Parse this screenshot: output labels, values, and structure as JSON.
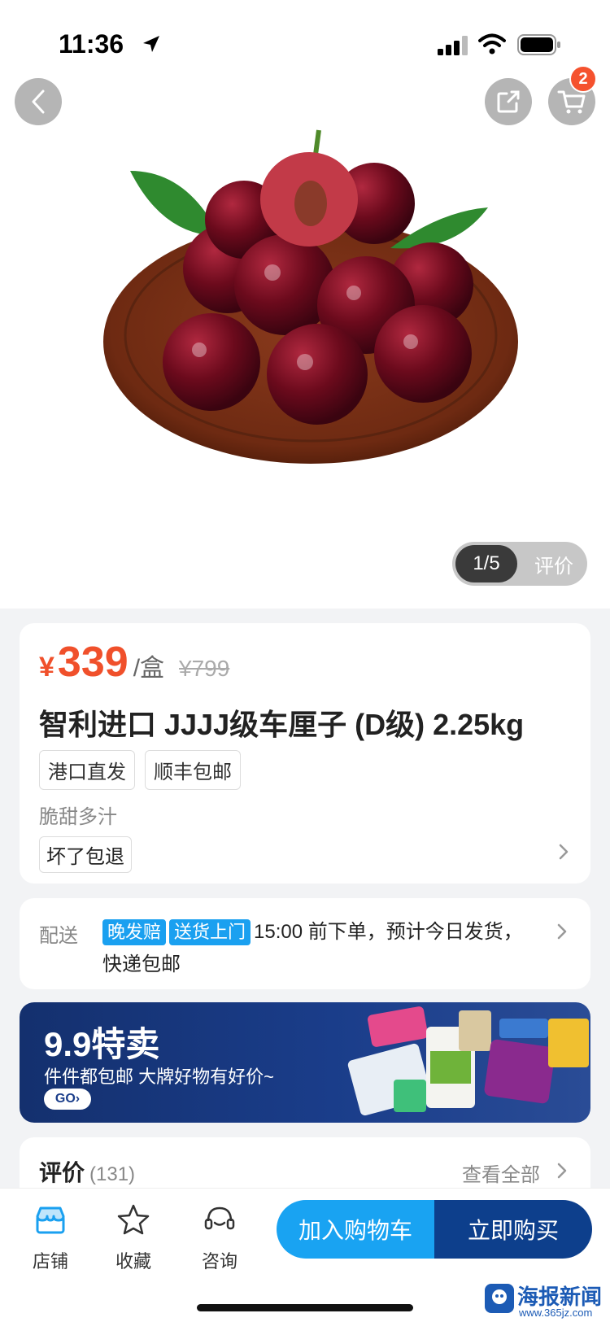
{
  "status_bar": {
    "time": "11:36"
  },
  "header": {
    "cart_badge": "2"
  },
  "gallery": {
    "indicator": "1/5",
    "review_tab": "评价"
  },
  "product": {
    "currency": "¥",
    "price": "339",
    "unit": "/盒",
    "original_price": "¥799",
    "title": "智利进口 JJJJ级车厘子 (D级) 2.25kg",
    "tags": [
      "港口直发",
      "顺丰包邮"
    ],
    "subtitle": "脆甜多汁",
    "policy": "坏了包退"
  },
  "delivery": {
    "label": "配送",
    "tag1": "晚发赔",
    "tag2": "送货上门",
    "text": "15:00 前下单，预计今日发货，快递包邮"
  },
  "promo": {
    "title": "9.9特卖",
    "subtitle": "件件都包邮 大牌好物有好价~",
    "go": "GO›"
  },
  "reviews": {
    "title": "评价",
    "count": "(131)",
    "view_all": "查看全部"
  },
  "bottom_bar": {
    "store": "店铺",
    "favorite": "收藏",
    "consult": "咨询",
    "add_to_cart": "加入购物车",
    "buy_now": "立即购买"
  },
  "watermark": {
    "name": "海报新闻",
    "url": "www.365jz.com"
  },
  "colors": {
    "price": "#f0502b",
    "accent_blue": "#19a3f2",
    "dark_blue": "#0d3f8c"
  }
}
